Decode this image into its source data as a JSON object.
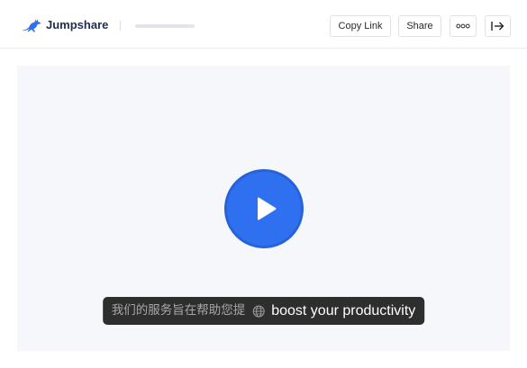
{
  "header": {
    "brand": {
      "name": "Jumpshare",
      "logo_icon": "kangaroo-icon"
    },
    "actions": {
      "copy_link_label": "Copy Link",
      "share_label": "Share",
      "more_icon": "more-options-icon",
      "exit_icon": "exit-icon"
    }
  },
  "player": {
    "play_icon": "play-icon",
    "caption": {
      "original_text": "我们的服务旨在帮助您提",
      "language_icon": "globe-icon",
      "translated_text": "boost your productivity"
    }
  },
  "colors": {
    "brand_blue": "#2f70f1",
    "brand_text": "#1f2d52",
    "panel_background": "#f6f7fb",
    "caption_background": "#2e2e2e"
  }
}
